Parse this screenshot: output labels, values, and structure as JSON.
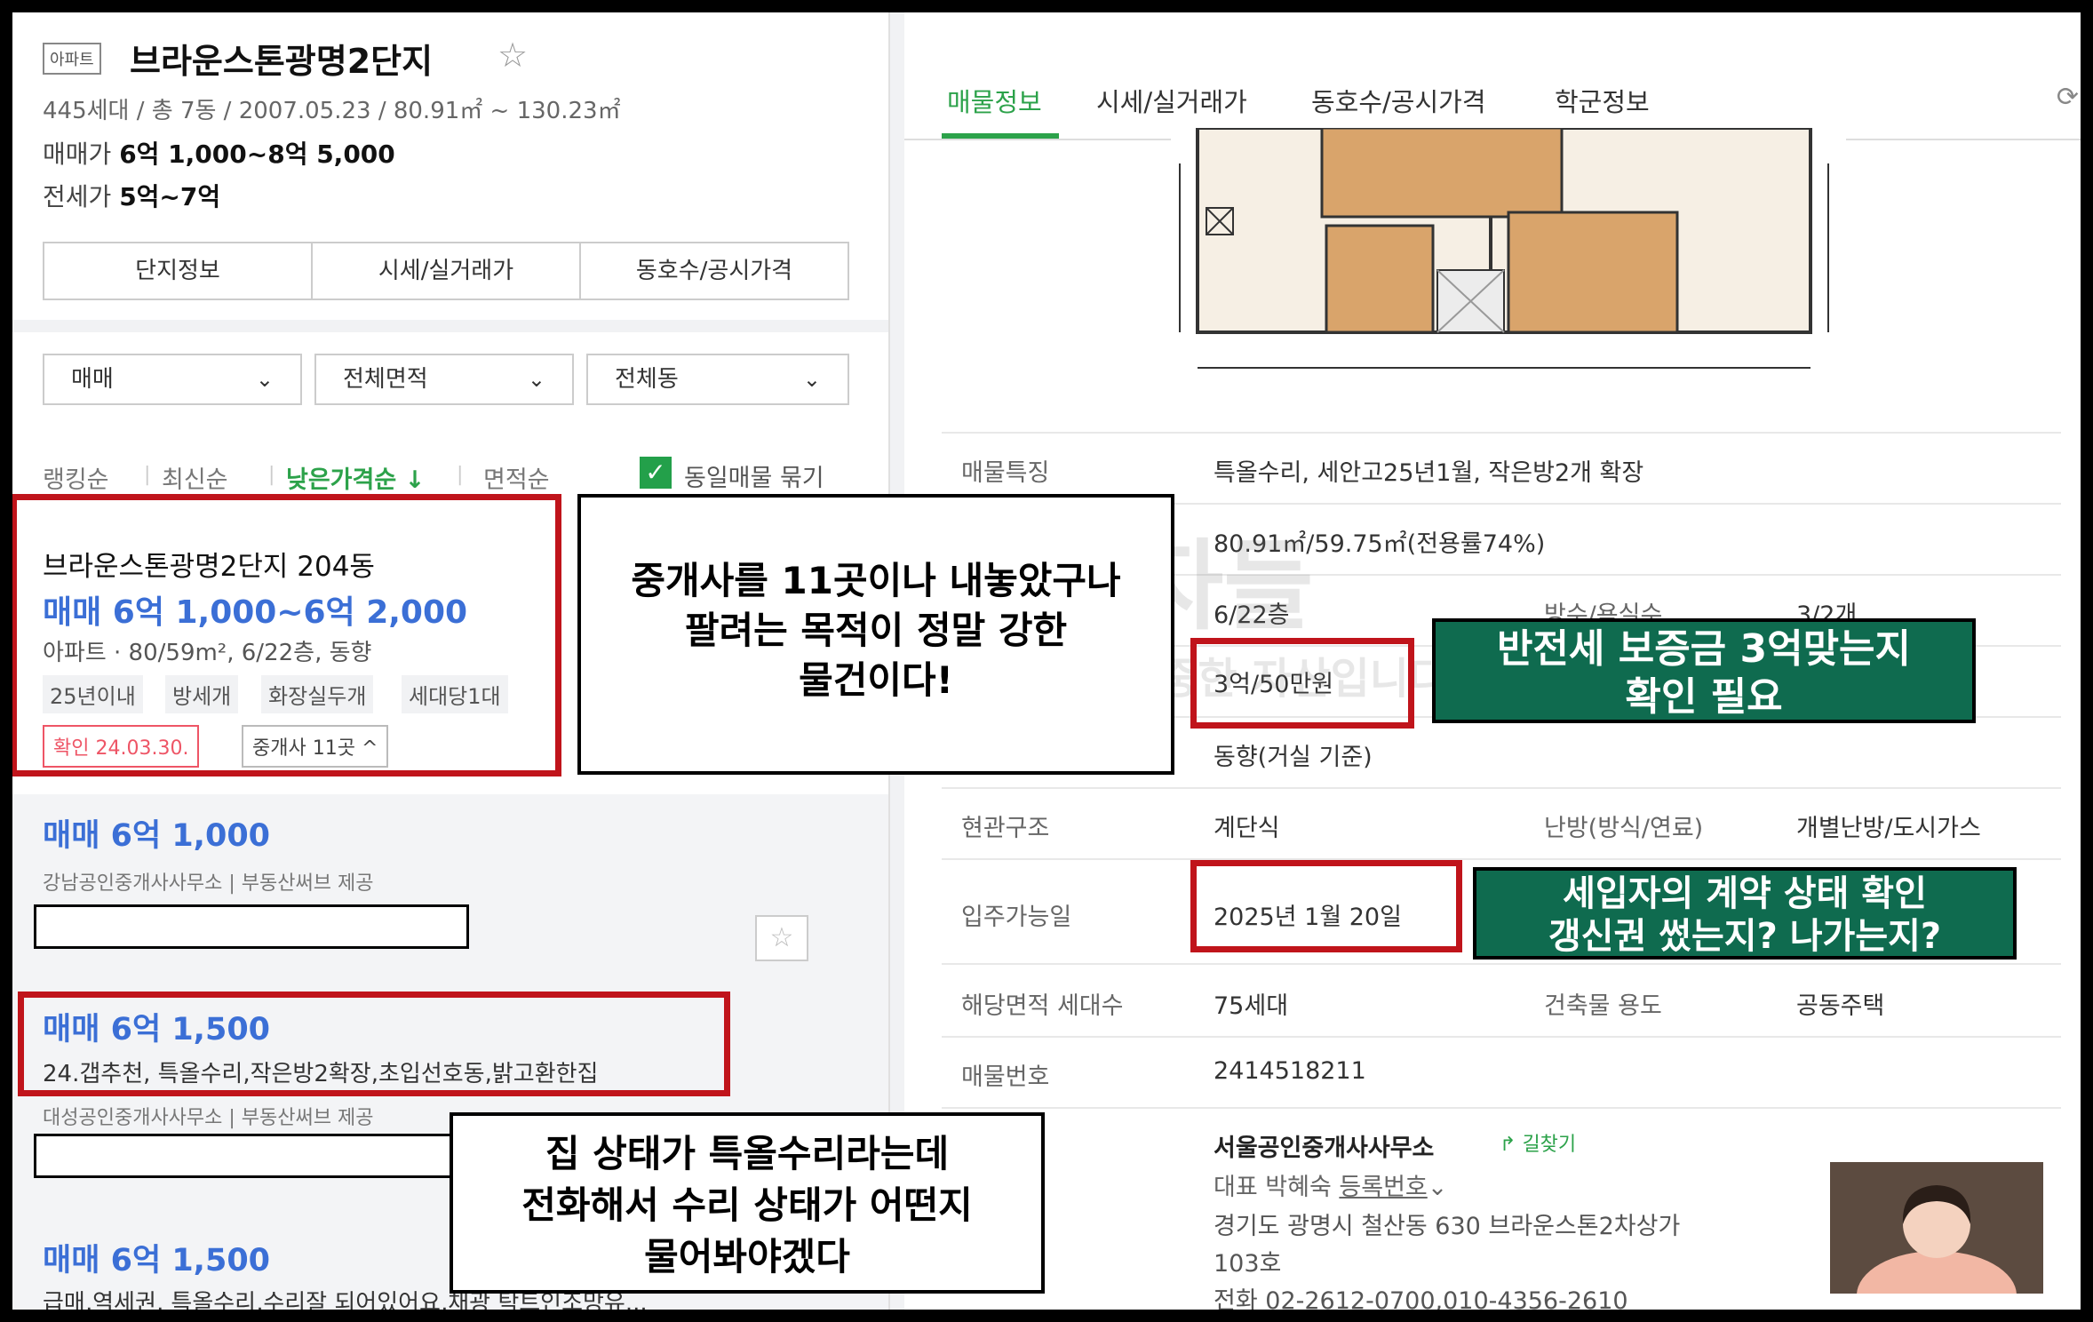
{
  "left": {
    "type_badge": "아파트",
    "complex_name": "브라운스톤광명2단지",
    "meta": "445세대 / 총 7동 / 2007.05.23 / 80.91㎡ ~ 130.23㎡",
    "sale_label": "매매가",
    "sale_range": "6억 1,000~8억 5,000",
    "jeonse_label": "전세가",
    "jeonse_range": "5억~7억",
    "tabs": [
      "단지정보",
      "시세/실거래가",
      "동호수/공시가격"
    ],
    "filters": [
      "매매",
      "전체면적",
      "전체동"
    ],
    "sort": [
      "랭킹순",
      "최신순",
      "낮은가격순 ↓",
      "면적순"
    ],
    "same_listing": "동일매물 묶기",
    "featured": {
      "title": "브라운스톤광명2단지 204동",
      "price": "매매 6억 1,000~6억 2,000",
      "sub": "아파트 · 80/59m², 6/22층, 동향",
      "tags": [
        "25년이내",
        "방세개",
        "화장실두개",
        "세대당1대"
      ],
      "confirm": "확인 24.03.30.",
      "agents": "중개사 11곳 ^"
    },
    "listings": [
      {
        "price": "매매 6억 1,000",
        "sub": "강남공인중개사사무소 | 부동산써브 제공"
      },
      {
        "price": "매매 6억 1,500",
        "desc": "24.갭추천, 특올수리,작은방2확장,초입선호동,밝고환한집",
        "sub": "대성공인중개사사무소 | 부동산써브 제공"
      },
      {
        "price": "매매 6억 1,500",
        "desc": "급매,역세권, 특올수리,수리잘 되어있어요,채광 탁트인조망유..."
      }
    ]
  },
  "right": {
    "tabs": [
      "매물정보",
      "시세/실거래가",
      "동호수/공시가격",
      "학군정보"
    ],
    "rows": {
      "feature_label": "매물특징",
      "feature_value": "특올수리, 세안고25년1월, 작은방2개 확장",
      "area_value": "80.91㎡/59.75㎡(전용률74%)",
      "floor_value": "6/22층",
      "rooms_label": "방수/욕실수",
      "rooms_value": "3/2개",
      "deposit_value": "3억/50만원",
      "direction_value": "동향(거실 기준)",
      "entrance_label": "현관구조",
      "entrance_value": "계단식",
      "heating_label": "난방(방식/연료)",
      "heating_value": "개별난방/도시가스",
      "movein_label": "입주가능일",
      "movein_value": "2025년 1월 20일",
      "households_label": "해당면적 세대수",
      "households_value": "75세대",
      "building_label": "건축물 용도",
      "building_value": "공동주택",
      "listing_no_label": "매물번호",
      "listing_no_value": "2414518211"
    },
    "agent": {
      "name": "서울공인중개사사무소",
      "directions": "길찾기",
      "rep": "대표 박혜숙",
      "reg": "등록번호",
      "address1": "경기도 광명시 철산동 630 브라운스톤2차상가",
      "address2": "103호",
      "phone": "전화 02-2612-0700,010-4356-2610"
    }
  },
  "annotations": {
    "agents_note": [
      "중개사를 11곳이나 내놓았구나",
      "팔려는 목적이 정말 강한",
      "물건이다!"
    ],
    "deposit_note": [
      "반전세 보증금 3억맞는지",
      "확인 필요"
    ],
    "tenant_note": [
      "세입자의 계약 상태 확인",
      "갱신권 썼는지? 나가는지?"
    ],
    "repair_note": [
      "집 상태가 특올수리라는데",
      "전화해서 수리 상태가 어떤지",
      "물어봐야겠다"
    ]
  },
  "watermark": {
    "line1": "월급쟁이부자들",
    "line2": "이 자료는 월급쟁이부자들의 소중한 자산입니다"
  },
  "colors": {
    "accent_green": "#2ca24a",
    "price_blue": "#3b6fd6",
    "highlight_red": "#c0141b",
    "callout_green": "#0f6b4f"
  }
}
